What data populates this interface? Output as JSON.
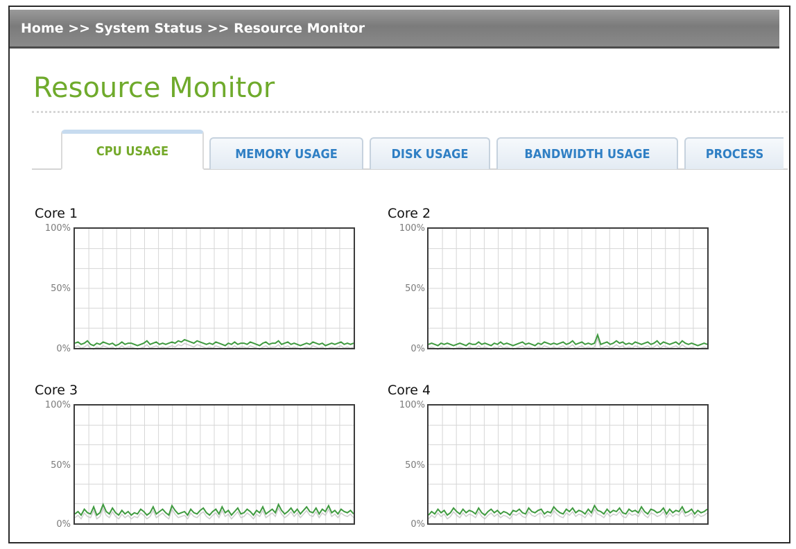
{
  "breadcrumb": {
    "home": "Home",
    "sep1": " >> ",
    "section": "System Status",
    "sep2": " >> ",
    "page": "Resource Monitor"
  },
  "page_title": "Resource Monitor",
  "tabs": [
    {
      "label": "CPU USAGE",
      "active": true
    },
    {
      "label": "MEMORY USAGE",
      "active": false
    },
    {
      "label": "DISK USAGE",
      "active": false
    },
    {
      "label": "BANDWIDTH USAGE",
      "active": false
    },
    {
      "label": "PROCESS",
      "active": false
    }
  ],
  "colors": {
    "accent_green": "#6faa2c",
    "tab_blue": "#2f7fc4",
    "series_green": "#3f9a3f"
  },
  "chart_data": [
    {
      "type": "line",
      "title": "Core 1",
      "yticks": [
        "100%",
        "50%",
        "0%"
      ],
      "ylim": [
        0,
        100
      ],
      "grid": true,
      "series": [
        {
          "values": [
            4,
            5,
            3,
            4,
            6,
            3,
            2,
            4,
            3,
            5,
            4,
            3,
            4,
            2,
            3,
            5,
            3,
            4,
            4,
            3,
            2,
            3,
            4,
            6,
            3,
            4,
            5,
            3,
            4,
            3,
            4,
            5,
            4,
            6,
            5,
            7,
            6,
            5,
            4,
            6,
            5,
            4,
            3,
            4,
            3,
            5,
            4,
            3,
            2,
            4,
            3,
            5,
            3,
            4,
            4,
            3,
            5,
            4,
            3,
            2,
            4,
            5,
            3,
            4,
            4,
            6,
            3,
            4,
            5,
            3,
            4,
            3,
            2,
            3,
            4,
            3,
            5,
            4,
            3,
            4,
            2,
            3,
            4,
            3,
            4,
            5,
            3,
            4,
            3,
            4
          ]
        }
      ]
    },
    {
      "type": "line",
      "title": "Core 2",
      "yticks": [
        "100%",
        "50%",
        "0%"
      ],
      "ylim": [
        0,
        100
      ],
      "grid": true,
      "series": [
        {
          "values": [
            3,
            4,
            3,
            2,
            4,
            3,
            4,
            3,
            2,
            3,
            4,
            3,
            2,
            4,
            3,
            3,
            5,
            3,
            4,
            3,
            2,
            4,
            3,
            5,
            3,
            4,
            3,
            2,
            3,
            4,
            5,
            3,
            4,
            3,
            2,
            4,
            3,
            5,
            4,
            3,
            4,
            3,
            4,
            5,
            3,
            4,
            6,
            3,
            4,
            5,
            3,
            4,
            3,
            4,
            11,
            3,
            4,
            5,
            3,
            4,
            6,
            4,
            5,
            3,
            4,
            3,
            5,
            4,
            3,
            4,
            5,
            3,
            4,
            6,
            3,
            5,
            4,
            3,
            4,
            5,
            3,
            6,
            4,
            3,
            4,
            3,
            2,
            3,
            4,
            3
          ]
        }
      ]
    },
    {
      "type": "line",
      "title": "Core 3",
      "yticks": [
        "100%",
        "50%",
        "0%"
      ],
      "ylim": [
        0,
        100
      ],
      "grid": true,
      "series": [
        {
          "values": [
            8,
            10,
            7,
            12,
            9,
            8,
            14,
            7,
            9,
            16,
            10,
            8,
            13,
            9,
            7,
            11,
            8,
            10,
            7,
            9,
            8,
            12,
            10,
            7,
            9,
            14,
            8,
            10,
            12,
            9,
            7,
            15,
            11,
            8,
            9,
            10,
            7,
            12,
            9,
            8,
            11,
            13,
            9,
            7,
            10,
            12,
            8,
            14,
            9,
            11,
            7,
            10,
            13,
            8,
            9,
            12,
            10,
            7,
            11,
            9,
            14,
            8,
            10,
            12,
            9,
            16,
            11,
            8,
            10,
            13,
            9,
            12,
            8,
            11,
            14,
            10,
            9,
            13,
            8,
            12,
            10,
            15,
            9,
            11,
            8,
            12,
            10,
            9,
            11,
            8
          ]
        }
      ]
    },
    {
      "type": "line",
      "title": "Core 4",
      "yticks": [
        "100%",
        "50%",
        "0%"
      ],
      "ylim": [
        0,
        100
      ],
      "grid": true,
      "series": [
        {
          "values": [
            7,
            10,
            8,
            12,
            9,
            11,
            7,
            9,
            13,
            10,
            8,
            12,
            9,
            11,
            10,
            8,
            13,
            9,
            7,
            10,
            12,
            9,
            11,
            8,
            10,
            9,
            7,
            11,
            10,
            12,
            9,
            8,
            13,
            10,
            9,
            11,
            12,
            8,
            10,
            9,
            14,
            11,
            9,
            8,
            12,
            10,
            13,
            9,
            11,
            10,
            8,
            12,
            9,
            15,
            11,
            10,
            8,
            12,
            9,
            11,
            10,
            13,
            9,
            8,
            12,
            10,
            11,
            9,
            14,
            10,
            8,
            12,
            11,
            9,
            10,
            13,
            8,
            12,
            9,
            11,
            10,
            14,
            9,
            10,
            12,
            8,
            11,
            9,
            10,
            12
          ]
        }
      ]
    }
  ]
}
